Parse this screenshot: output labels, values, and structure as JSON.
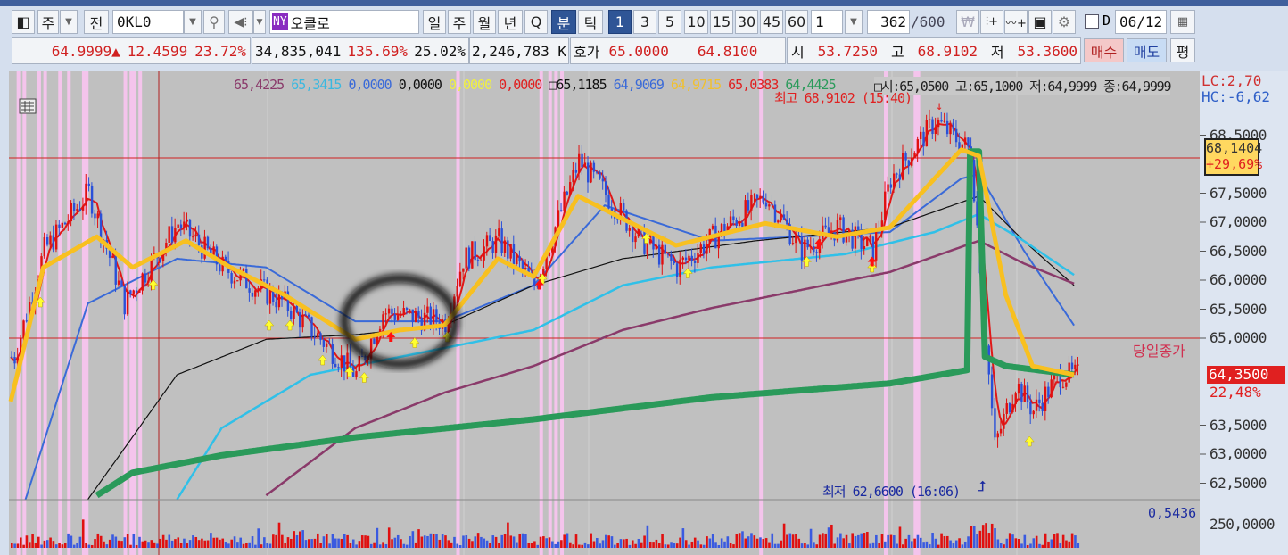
{
  "toolbar": {
    "market_type": "주",
    "dropdown": "▼",
    "all_label": "전",
    "symbol": "0KL0",
    "exchange_badge": "NY",
    "stock_name": "오클로",
    "periods": [
      "일",
      "주",
      "월",
      "년",
      "Q",
      "분",
      "틱"
    ],
    "active_period": "분",
    "minute_options": [
      "1",
      "3",
      "5",
      "10",
      "15",
      "30",
      "45",
      "60"
    ],
    "active_minute": "1",
    "interval_value": "1",
    "count_value": "362",
    "count_total": "/600",
    "date_label": "D",
    "date_value": "06/12"
  },
  "quote": {
    "price": "64.9999",
    "change_arrow": "▲",
    "change": "12.4599",
    "change_pct": "23.72%",
    "volume": "34,835,041",
    "volume_ratio": "135.69%",
    "turnover": "25.02%",
    "amount": "2,246,783 K",
    "hoga_label": "호가",
    "ask": "65.0000",
    "bid": "64.8100",
    "open_label": "시",
    "open": "53.7250",
    "high_label": "고",
    "high": "68.9102",
    "low_label": "저",
    "low": "53.3600",
    "buy_label": "매수",
    "sell_label": "매도",
    "avg_label": "평"
  },
  "legend": {
    "values": [
      {
        "text": "65,4225",
        "color": "#8a3a6a"
      },
      {
        "text": "65,3415",
        "color": "#3ab8e0"
      },
      {
        "text": "0,0000",
        "color": "#3a6ad8"
      },
      {
        "text": "0,0000",
        "color": "#111111"
      },
      {
        "text": "0,0000",
        "color": "#f0f040"
      },
      {
        "text": "0,0000",
        "color": "#e02020"
      },
      {
        "text": "□65,1185",
        "color": "#111111"
      },
      {
        "text": "64,9069",
        "color": "#3a6ad8"
      },
      {
        "text": "64,9715",
        "color": "#f0c030"
      },
      {
        "text": "65,0383",
        "color": "#e02020"
      },
      {
        "text": "64,4425",
        "color": "#2a9a5a"
      }
    ],
    "ohlc": "□시:65,0500 고:65,1000 저:64,9999 종:64,9999",
    "lc": "LC:2,70",
    "hc": "HC:-6,62"
  },
  "annotations": {
    "high_label": "최고 68,9102 (15:40)",
    "low_label": "최저 62,6600 (16:06)",
    "prev_close_label": "당일종가",
    "crosshair_price": "68,1404",
    "crosshair_pct": "+29,69%",
    "current_price": "64,3500",
    "current_pct": "22,48%",
    "volume_value": "0,5436",
    "volume_axis": "250,0000"
  },
  "chart_data": {
    "type": "candlestick",
    "y_ticks": [
      "68,5000",
      "67,5000",
      "67,0000",
      "66,5000",
      "66,0000",
      "65,5000",
      "65,0000",
      "63,5000",
      "63,0000",
      "62,5000"
    ],
    "ylim": [
      62.2,
      69.6
    ],
    "bars": 362,
    "price_path": [
      [
        1,
        64.68
      ],
      [
        11,
        66.52
      ],
      [
        26,
        67.52
      ],
      [
        38,
        65.6
      ],
      [
        56,
        66.98
      ],
      [
        71,
        66.22
      ],
      [
        92,
        65.6
      ],
      [
        116,
        64.37
      ],
      [
        125,
        65.45
      ],
      [
        146,
        65.29
      ],
      [
        152,
        66.37
      ],
      [
        164,
        66.68
      ],
      [
        176,
        65.91
      ],
      [
        191,
        68.06
      ],
      [
        203,
        67.29
      ],
      [
        212,
        66.68
      ],
      [
        224,
        66.22
      ],
      [
        242,
        66.98
      ],
      [
        254,
        67.45
      ],
      [
        266,
        66.52
      ],
      [
        278,
        66.91
      ],
      [
        290,
        66.52
      ],
      [
        296,
        67.75
      ],
      [
        311,
        68.75
      ],
      [
        323,
        68.22
      ],
      [
        329,
        64.37
      ],
      [
        331,
        63.14
      ],
      [
        338,
        64.22
      ],
      [
        344,
        63.75
      ],
      [
        353,
        64.37
      ],
      [
        358,
        64.35
      ]
    ],
    "ma": [
      {
        "color": "#3a6ad8",
        "width": 2,
        "points": [
          [
            5,
            62.22
          ],
          [
            26,
            65.6
          ],
          [
            56,
            66.37
          ],
          [
            86,
            66.22
          ],
          [
            116,
            65.29
          ],
          [
            146,
            65.29
          ],
          [
            176,
            65.91
          ],
          [
            200,
            67.29
          ],
          [
            236,
            66.68
          ],
          [
            266,
            66.75
          ],
          [
            296,
            66.83
          ],
          [
            320,
            67.75
          ],
          [
            326,
            67.83
          ],
          [
            341,
            66.52
          ],
          [
            358,
            65.22
          ]
        ]
      },
      {
        "color": "#111111",
        "width": 1.2,
        "points": [
          [
            26,
            62.22
          ],
          [
            56,
            64.37
          ],
          [
            86,
            64.98
          ],
          [
            116,
            65.06
          ],
          [
            146,
            65.22
          ],
          [
            176,
            65.91
          ],
          [
            206,
            66.37
          ],
          [
            251,
            66.68
          ],
          [
            296,
            66.91
          ],
          [
            326,
            67.45
          ],
          [
            341,
            66.68
          ],
          [
            358,
            65.91
          ]
        ]
      },
      {
        "color": "#30c0e8",
        "width": 2.5,
        "points": [
          [
            56,
            62.22
          ],
          [
            71,
            63.45
          ],
          [
            101,
            64.37
          ],
          [
            146,
            64.83
          ],
          [
            176,
            65.14
          ],
          [
            206,
            65.91
          ],
          [
            236,
            66.22
          ],
          [
            281,
            66.45
          ],
          [
            311,
            66.83
          ],
          [
            326,
            67.14
          ],
          [
            341,
            66.68
          ],
          [
            358,
            66.09
          ]
        ]
      },
      {
        "color": "#8a3a6a",
        "width": 2.5,
        "points": [
          [
            86,
            62.29
          ],
          [
            116,
            63.45
          ],
          [
            146,
            64.06
          ],
          [
            176,
            64.52
          ],
          [
            206,
            65.14
          ],
          [
            236,
            65.52
          ],
          [
            266,
            65.83
          ],
          [
            296,
            66.14
          ],
          [
            326,
            66.68
          ],
          [
            341,
            66.29
          ],
          [
            358,
            65.94
          ]
        ]
      },
      {
        "color": "#2a9a5a",
        "width": 7,
        "points": [
          [
            29,
            62.29
          ],
          [
            41,
            62.68
          ],
          [
            71,
            62.98
          ],
          [
            116,
            63.29
          ],
          [
            176,
            63.6
          ],
          [
            236,
            63.98
          ],
          [
            296,
            64.22
          ],
          [
            322,
            64.45
          ],
          [
            323,
            68.22
          ],
          [
            326,
            68.22
          ],
          [
            328,
            64.68
          ],
          [
            335,
            64.52
          ],
          [
            358,
            64.37
          ]
        ]
      },
      {
        "color": "#f8c020",
        "width": 5,
        "points": [
          [
            0,
            63.91
          ],
          [
            11,
            66.22
          ],
          [
            29,
            66.75
          ],
          [
            41,
            66.22
          ],
          [
            59,
            66.68
          ],
          [
            74,
            66.22
          ],
          [
            92,
            65.75
          ],
          [
            116,
            64.98
          ],
          [
            131,
            65.14
          ],
          [
            146,
            65.22
          ],
          [
            164,
            66.37
          ],
          [
            176,
            66.06
          ],
          [
            191,
            67.45
          ],
          [
            206,
            67.06
          ],
          [
            224,
            66.6
          ],
          [
            254,
            66.98
          ],
          [
            278,
            66.75
          ],
          [
            296,
            66.91
          ],
          [
            311,
            67.75
          ],
          [
            320,
            68.25
          ],
          [
            326,
            68.14
          ],
          [
            335,
            65.75
          ],
          [
            344,
            64.52
          ],
          [
            358,
            64.37
          ]
        ]
      }
    ],
    "highlight_bars": [
      2,
      4,
      9,
      11,
      16,
      19,
      24,
      25,
      38,
      40,
      41,
      43,
      150,
      178,
      181,
      183,
      185,
      252,
      294,
      304,
      305
    ],
    "yellow_arrows": [
      [
        10,
        65.6
      ],
      [
        48,
        65.9
      ],
      [
        87,
        65.2
      ],
      [
        94,
        65.2
      ],
      [
        105,
        64.6
      ],
      [
        114,
        64.4
      ],
      [
        119,
        64.3
      ],
      [
        136,
        64.9
      ],
      [
        147,
        65.0
      ],
      [
        179,
        66.0
      ],
      [
        214,
        66.7
      ],
      [
        228,
        66.1
      ],
      [
        268,
        66.3
      ],
      [
        290,
        66.2
      ],
      [
        343,
        63.2
      ]
    ],
    "red_arrows": [
      [
        128,
        65.0
      ],
      [
        178,
        65.9
      ],
      [
        272,
        66.6
      ],
      [
        290,
        66.3
      ]
    ]
  }
}
